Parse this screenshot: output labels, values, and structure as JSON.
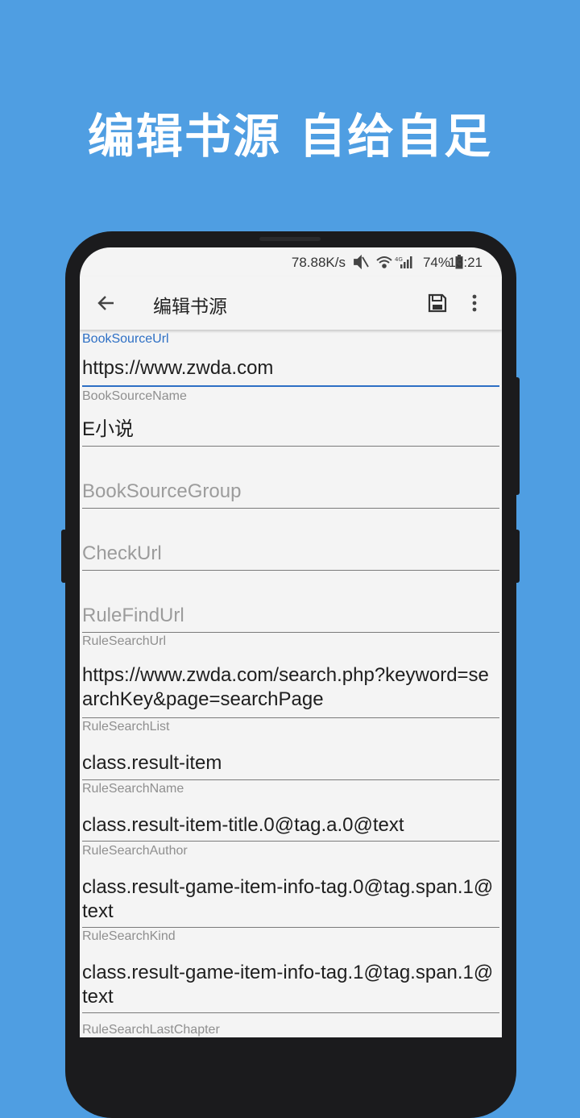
{
  "promo": {
    "headline": "编辑书源  自给自足"
  },
  "status_bar": {
    "net_speed": "78.88K/s",
    "battery_percent": "74%",
    "time": "13:21"
  },
  "toolbar": {
    "title": "编辑书源"
  },
  "fields": [
    {
      "label": "BookSourceUrl",
      "value": "https://www.zwda.com"
    },
    {
      "label": "BookSourceName",
      "value": "E小说"
    },
    {
      "placeholder": "BookSourceGroup"
    },
    {
      "placeholder": "CheckUrl"
    },
    {
      "placeholder": "RuleFindUrl"
    },
    {
      "label": "RuleSearchUrl",
      "value": "https://www.zwda.com/search.php?keyword=searchKey&page=searchPage"
    },
    {
      "label": "RuleSearchList",
      "value": "class.result-item"
    },
    {
      "label": "RuleSearchName",
      "value": "class.result-item-title.0@tag.a.0@text"
    },
    {
      "label": "RuleSearchAuthor",
      "value": "class.result-game-item-info-tag.0@tag.span.1@text"
    },
    {
      "label": "RuleSearchKind",
      "value": "class.result-game-item-info-tag.1@tag.span.1@text"
    },
    {
      "label": "RuleSearchLastChapter"
    }
  ],
  "colors": {
    "background": "#4f9ee2",
    "accent": "#2d6fc4",
    "phone_frame": "#1b1b1d",
    "screen": "#f4f4f4"
  }
}
